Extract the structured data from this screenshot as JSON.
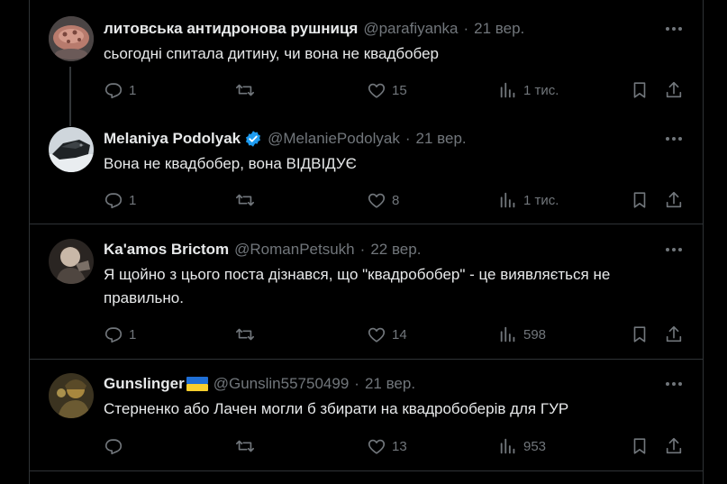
{
  "tweets": [
    {
      "name": "литовська антидронова рушниця",
      "handle": "@parafiyanka",
      "date": "21 вер.",
      "text": [
        "сьогодні спитала дитину, чи вона не квадбобер"
      ],
      "replies": "1",
      "reposts": "",
      "likes": "15",
      "views": "1 тис."
    },
    {
      "name": "Melaniya Podolyak",
      "handle": "@MelaniePodolyak",
      "date": "21 вер.",
      "text": [
        "Вона не квадбобер, вона ВІДВІДУЄ"
      ],
      "replies": "1",
      "reposts": "",
      "likes": "8",
      "views": "1 тис."
    },
    {
      "name": "Ka'amos Brictom",
      "handle": "@RomanPetsukh",
      "date": "22 вер.",
      "text": [
        "Я щойно з цього поста дізнався, що \"квадробобер\" - це виявляється не",
        "правильно."
      ],
      "replies": "1",
      "reposts": "",
      "likes": "14",
      "views": "598"
    },
    {
      "name": "Gunslinger",
      "handle": "@Gunslin55750499",
      "date": "21 вер.",
      "text": [
        "Стерненко або Лачен могли б збирати на квадробоберів для ГУР"
      ],
      "replies": "",
      "reposts": "",
      "likes": "13",
      "views": "953"
    }
  ],
  "colors": {
    "background": "#000000",
    "text": "#e7e9ea",
    "muted": "#71767b",
    "divider": "#2f3336",
    "verified": "#1d9bf0"
  },
  "icons": {
    "reply": "reply-icon",
    "repost": "repost-icon",
    "like": "heart-icon",
    "views": "views-icon",
    "bookmark": "bookmark-icon",
    "share": "share-icon",
    "more": "more-icon"
  }
}
